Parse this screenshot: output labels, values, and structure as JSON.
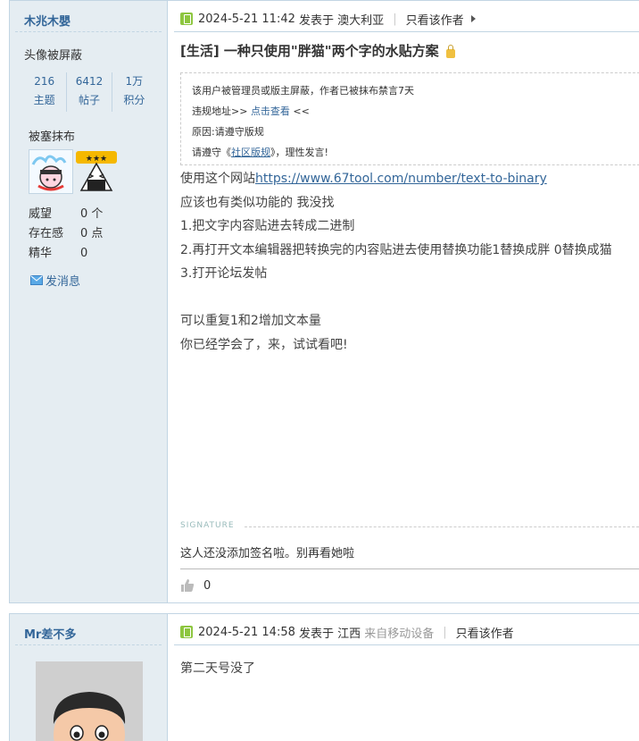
{
  "post1": {
    "author": "木兆木嬰",
    "avatar_notice": "头像被屏蔽",
    "stats": [
      {
        "num": "216",
        "label": "主题"
      },
      {
        "num": "6412",
        "label": "帖子"
      },
      {
        "num": "1万",
        "label": "积分"
      }
    ],
    "medal_title": "被塞抹布",
    "props": [
      {
        "label": "威望",
        "value": "0 个"
      },
      {
        "label": "存在感",
        "value": "0 点"
      },
      {
        "label": "精华",
        "value": "0"
      }
    ],
    "pm_label": "发消息",
    "meta": {
      "time": "2024-5-21 11:42",
      "posted_in": "发表于",
      "location": "澳大利亚",
      "only_author": "只看该作者"
    },
    "title": "[生活] 一种只使用\"胖猫\"两个字的水贴方案",
    "notice": {
      "line1": "该用户被管理员或版主屏蔽，作者已被抹布禁言7天",
      "line2_prefix": "违规地址>> ",
      "line2_link": "点击查看",
      "line2_suffix": " <<",
      "line3": "原因:请遵守版规",
      "line4_prefix": "请遵守《",
      "line4_link": "社区版规",
      "line4_suffix": "》，理性发言!"
    },
    "body": {
      "line1_prefix": "使用这个网站",
      "line1_link": "https://www.67tool.com/number/text-to-binary",
      "line2": "应该也有类似功能的 我没找",
      "line3": "1.把文字内容贴进去转成二进制",
      "line4": "2.再打开文本编辑器把转换完的内容贴进去使用替换功能1替换成胖 0替换成猫",
      "line5": "3.打开论坛发帖",
      "line6": "可以重复1和2增加文本量",
      "line7": "你已经学会了，来，试试看吧!"
    },
    "signature_label": "SIGNATURE",
    "signature_text": "这人还没添加签名啦。别再看她啦",
    "like_count": "0"
  },
  "post2": {
    "author": "Mr差不多",
    "meta": {
      "time": "2024-5-21 14:58",
      "posted_in": "发表于",
      "location": "江西",
      "device": "来自移动设备",
      "only_author": "只看该作者"
    },
    "body": "第二天号没了"
  },
  "colors": {
    "sidebar_bg": "#e5edf2",
    "border": "#c2d5e3",
    "link": "#336699"
  }
}
